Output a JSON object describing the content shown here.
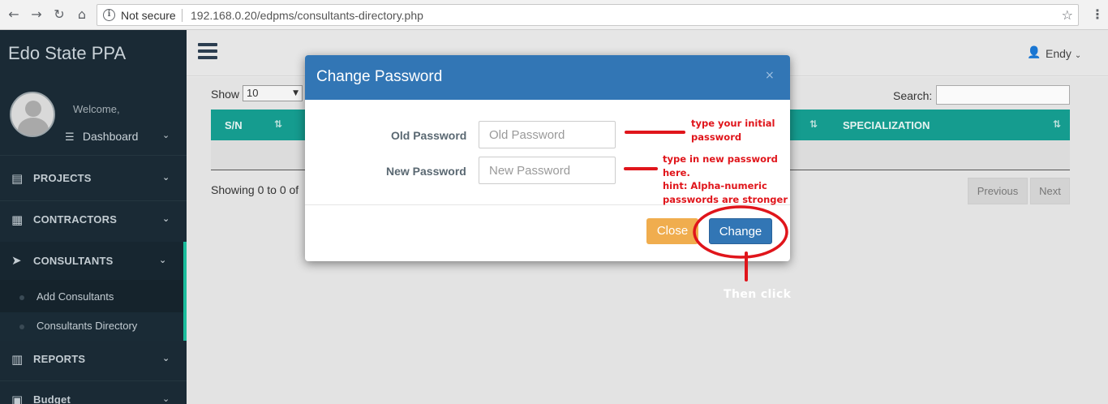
{
  "browser": {
    "security_label": "Not secure",
    "url": "192.168.0.20/edpms/consultants-directory.php",
    "back_icon": "arrow-left-icon",
    "forward_icon": "arrow-right-icon",
    "reload_icon": "reload-icon",
    "home_icon": "home-icon"
  },
  "sidebar": {
    "brand": "Edo State PPA",
    "welcome": "Welcome,",
    "dashboard_label": "Dashboard",
    "items": [
      {
        "label": "PROJECTS",
        "icon": "list-icon"
      },
      {
        "label": "CONTRACTORS",
        "icon": "building-icon"
      },
      {
        "label": "CONSULTANTS",
        "icon": "paper-plane-icon",
        "active": true
      },
      {
        "label": "REPORTS",
        "icon": "bar-chart-icon"
      },
      {
        "label": "Budget",
        "icon": "money-icon"
      }
    ],
    "submenu": [
      {
        "label": "Add Consultants"
      },
      {
        "label": "Consultants Directory",
        "current": true
      }
    ]
  },
  "topbar": {
    "user_name": "Endy"
  },
  "table_controls": {
    "show_label": "Show",
    "show_value": "10",
    "search_label": "Search:",
    "columns": [
      "S/N",
      "SPECIALIZATION"
    ],
    "info": "Showing 0 to 0 of",
    "previous": "Previous",
    "next": "Next"
  },
  "modal": {
    "title": "Change Password",
    "close_x": "×",
    "old_password_label": "Old Password",
    "old_password_placeholder": "Old Password",
    "new_password_label": "New Password",
    "new_password_placeholder": "New Password",
    "close_button": "Close",
    "change_button": "Change"
  },
  "annotations": {
    "old_hint_1": "type your initial",
    "old_hint_2": "password",
    "new_hint_1": "type in new password",
    "new_hint_2": "here.",
    "new_hint_3": "hint: Alpha-numeric",
    "new_hint_4": "passwords are stronger",
    "then_click": "Then click",
    "annotation_color": "#e0151b"
  },
  "colors": {
    "sidebar_bg": "#1a2a35",
    "accent_teal": "#159c8f",
    "modal_header": "#3276b5",
    "btn_close": "#f0ad4e"
  }
}
